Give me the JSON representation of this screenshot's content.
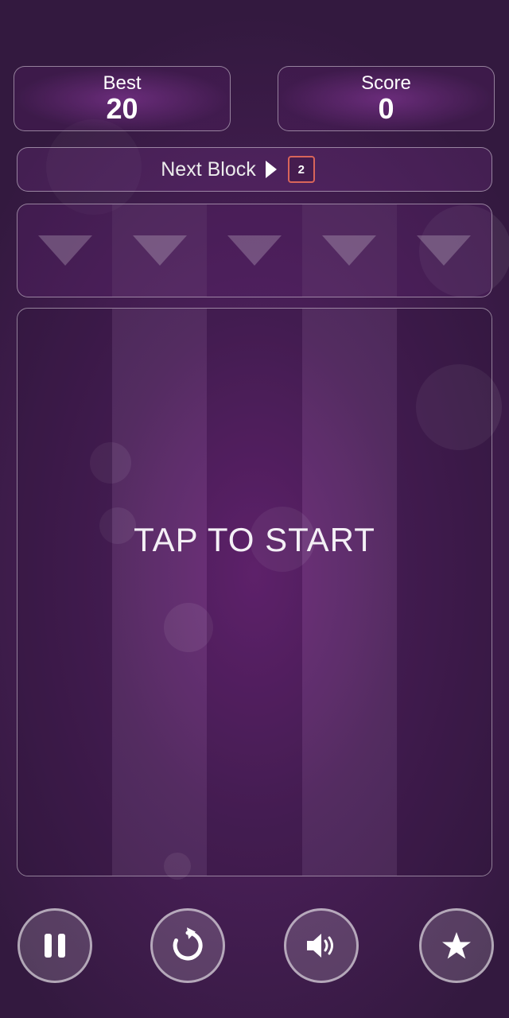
{
  "scores": {
    "best_label": "Best",
    "best_value": "20",
    "score_label": "Score",
    "score_value": "0"
  },
  "next_block": {
    "label": "Next Block",
    "value": "2",
    "tile_color": "#d9655a"
  },
  "drop_columns": [
    {
      "icon": "down-triangle-icon"
    },
    {
      "icon": "down-triangle-icon"
    },
    {
      "icon": "down-triangle-icon"
    },
    {
      "icon": "down-triangle-icon"
    },
    {
      "icon": "down-triangle-icon"
    }
  ],
  "board": {
    "columns": 5,
    "message": "TAP TO START"
  },
  "controls": [
    {
      "name": "pause",
      "icon": "pause-icon"
    },
    {
      "name": "restart",
      "icon": "restart-icon"
    },
    {
      "name": "sound",
      "icon": "speaker-icon"
    },
    {
      "name": "rate",
      "icon": "star-icon"
    }
  ],
  "colors": {
    "background_center": "#6a2577",
    "background_edge": "#33193f",
    "panel_border": "#ffffff",
    "accent": "#d9655a"
  }
}
